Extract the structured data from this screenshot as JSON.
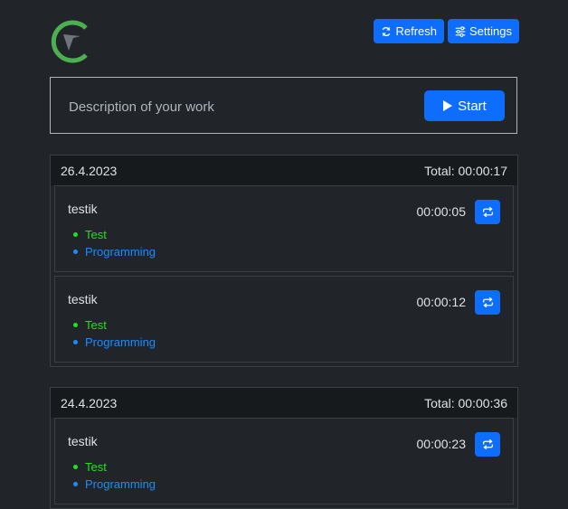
{
  "header": {
    "refresh_label": "Refresh",
    "settings_label": "Settings"
  },
  "new_entry": {
    "placeholder": "Description of your work",
    "start_label": "Start"
  },
  "colors": {
    "primary": "#0d6efd",
    "background": "#212529",
    "tag_test": "#19e619",
    "tag_programming": "#1a8cff",
    "logo": "#4caf50"
  },
  "days": [
    {
      "date": "26.4.2023",
      "total": "Total: 00:00:17",
      "entries": [
        {
          "title": "testik",
          "duration": "00:00:05",
          "tags": [
            "Test",
            "Programming"
          ]
        },
        {
          "title": "testik",
          "duration": "00:00:12",
          "tags": [
            "Test",
            "Programming"
          ]
        }
      ]
    },
    {
      "date": "24.4.2023",
      "total": "Total: 00:00:36",
      "entries": [
        {
          "title": "testik",
          "duration": "00:00:23",
          "tags": [
            "Test",
            "Programming"
          ]
        }
      ]
    }
  ]
}
